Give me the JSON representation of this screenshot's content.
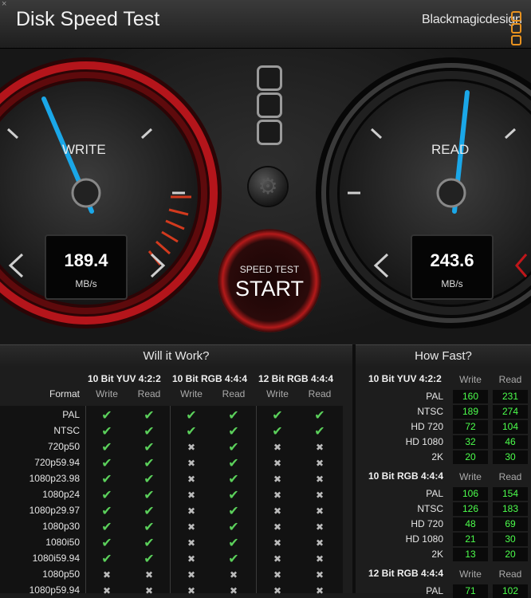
{
  "app": {
    "title": "Disk Speed Test",
    "brand": "Blackmagicdesign",
    "close": "×"
  },
  "gauges": {
    "write": {
      "label": "WRITE",
      "value": "189.4",
      "unit": "MB/s"
    },
    "read": {
      "label": "READ",
      "value": "243.6",
      "unit": "MB/s"
    }
  },
  "start_button": {
    "small": "SPEED TEST",
    "big": "START"
  },
  "settings_icon": "gear-icon",
  "will_it_work": {
    "title": "Will it Work?",
    "format_header": "Format",
    "groups": [
      "10 Bit YUV 4:2:2",
      "10 Bit RGB 4:4:4",
      "12 Bit RGB 4:4:4"
    ],
    "sub_headers": [
      "Write",
      "Read",
      "Write",
      "Read",
      "Write",
      "Read"
    ],
    "rows": [
      {
        "format": "PAL",
        "marks": [
          1,
          1,
          1,
          1,
          1,
          1
        ]
      },
      {
        "format": "NTSC",
        "marks": [
          1,
          1,
          1,
          1,
          1,
          1
        ]
      },
      {
        "format": "720p50",
        "marks": [
          1,
          1,
          0,
          1,
          0,
          0
        ]
      },
      {
        "format": "720p59.94",
        "marks": [
          1,
          1,
          0,
          1,
          0,
          0
        ]
      },
      {
        "format": "1080p23.98",
        "marks": [
          1,
          1,
          0,
          1,
          0,
          0
        ]
      },
      {
        "format": "1080p24",
        "marks": [
          1,
          1,
          0,
          1,
          0,
          0
        ]
      },
      {
        "format": "1080p29.97",
        "marks": [
          1,
          1,
          0,
          1,
          0,
          0
        ]
      },
      {
        "format": "1080p30",
        "marks": [
          1,
          1,
          0,
          1,
          0,
          0
        ]
      },
      {
        "format": "1080i50",
        "marks": [
          1,
          1,
          0,
          1,
          0,
          0
        ]
      },
      {
        "format": "1080i59.94",
        "marks": [
          1,
          1,
          0,
          1,
          0,
          0
        ]
      },
      {
        "format": "1080p50",
        "marks": [
          0,
          0,
          0,
          0,
          0,
          0
        ]
      },
      {
        "format": "1080p59.94",
        "marks": [
          0,
          0,
          0,
          0,
          0,
          0
        ]
      }
    ],
    "check_glyph": "✔",
    "cross_glyph": "✖"
  },
  "how_fast": {
    "title": "How Fast?",
    "col_write": "Write",
    "col_read": "Read",
    "sections": [
      {
        "name": "10 Bit YUV 4:2:2",
        "rows": [
          {
            "format": "PAL",
            "write": "160",
            "read": "231"
          },
          {
            "format": "NTSC",
            "write": "189",
            "read": "274"
          },
          {
            "format": "HD 720",
            "write": "72",
            "read": "104"
          },
          {
            "format": "HD 1080",
            "write": "32",
            "read": "46"
          },
          {
            "format": "2K",
            "write": "20",
            "read": "30"
          }
        ]
      },
      {
        "name": "10 Bit RGB 4:4:4",
        "rows": [
          {
            "format": "PAL",
            "write": "106",
            "read": "154"
          },
          {
            "format": "NTSC",
            "write": "126",
            "read": "183"
          },
          {
            "format": "HD 720",
            "write": "48",
            "read": "69"
          },
          {
            "format": "HD 1080",
            "write": "21",
            "read": "30"
          },
          {
            "format": "2K",
            "write": "13",
            "read": "20"
          }
        ]
      },
      {
        "name": "12 Bit RGB 4:4:4",
        "rows": [
          {
            "format": "PAL",
            "write": "71",
            "read": "102"
          }
        ]
      }
    ]
  },
  "colors": {
    "needle": "#1aa7e8",
    "accent_red": "#c0161a",
    "logo_orange": "#e8921f",
    "ok_green": "#5bd05b",
    "value_green": "#4cff4c"
  }
}
